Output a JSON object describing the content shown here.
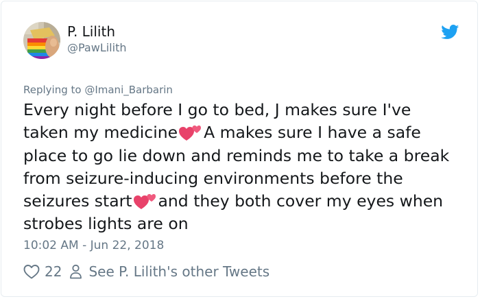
{
  "tweet": {
    "author": {
      "display_name": "P. Lilith",
      "handle": "@PawLilith",
      "avatar_icon": "rainbow-cake-photo"
    },
    "brand_icon": "twitter-bird-icon",
    "brand_color": "#1da1f2",
    "replying_to": "Replying to @Imani_Barbarin",
    "text_segments": [
      "Every night before I go to bed, J makes sure I've",
      "taken my medicine",
      "A makes sure I have a safe",
      "place to go lie down and reminds me to take a break",
      "from seizure-inducing environments before the",
      "seizures start",
      "and they both cover my eyes when",
      "strobes lights are on"
    ],
    "emoji": "two-hearts-emoji",
    "timestamp": "10:02 AM - Jun 22, 2018",
    "like_count": "22",
    "like_icon": "heart-outline-icon",
    "user_icon": "person-outline-icon",
    "see_others_label": "See P. Lilith's other Tweets"
  }
}
